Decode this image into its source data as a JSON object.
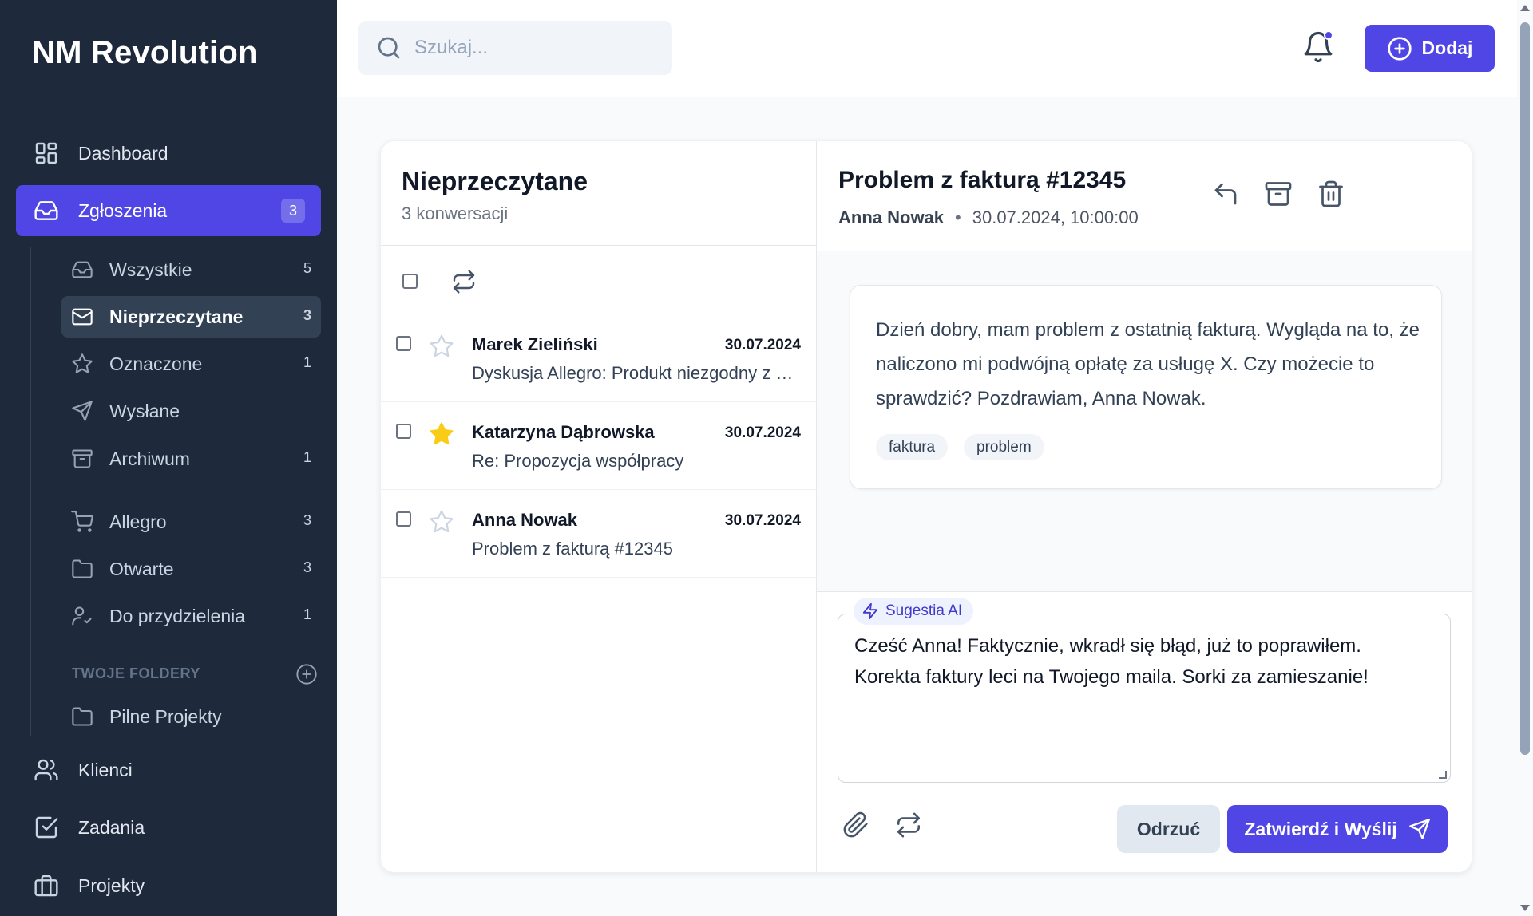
{
  "app": {
    "brand": "NM Revolution"
  },
  "nav": {
    "dashboard": "Dashboard",
    "tickets": {
      "label": "Zgłoszenia",
      "badge": "3"
    },
    "clients": "Klienci",
    "tasks": "Zadania",
    "projects": "Projekty"
  },
  "subnav": [
    {
      "label": "Wszystkie",
      "count": "5",
      "icon": "inbox-icon"
    },
    {
      "label": "Nieprzeczytane",
      "count": "3",
      "icon": "mail-icon"
    },
    {
      "label": "Oznaczone",
      "count": "1",
      "icon": "star-icon"
    },
    {
      "label": "Wysłane",
      "count": "",
      "icon": "send-icon"
    },
    {
      "label": "Archiwum",
      "count": "1",
      "icon": "archive-icon"
    },
    {
      "label": "Allegro",
      "count": "3",
      "icon": "cart-icon"
    },
    {
      "label": "Otwarte",
      "count": "3",
      "icon": "folder-icon"
    },
    {
      "label": "Do przydzielenia",
      "count": "1",
      "icon": "user-check-icon"
    }
  ],
  "folders": {
    "header": "TWOJE FOLDERY",
    "items": [
      {
        "label": "Pilne Projekty",
        "icon": "folder-icon"
      }
    ]
  },
  "topbar": {
    "search_placeholder": "Szukaj...",
    "add_label": "Dodaj"
  },
  "list": {
    "title": "Nieprzeczytane",
    "subtitle": "3 konwersacji",
    "conversations": [
      {
        "name": "Marek Zieliński",
        "date": "30.07.2024",
        "subject": "Dyskusja Allegro: Produkt niezgodny z opisem",
        "starred": false
      },
      {
        "name": "Katarzyna Dąbrowska",
        "date": "30.07.2024",
        "subject": "Re: Propozycja współpracy",
        "starred": true
      },
      {
        "name": "Anna Nowak",
        "date": "30.07.2024",
        "subject": "Problem z fakturą #12345",
        "starred": false
      }
    ]
  },
  "detail": {
    "title": "Problem z fakturą #12345",
    "author": "Anna Nowak",
    "separator": "•",
    "datetime": "30.07.2024, 10:00:00",
    "message": "Dzień dobry, mam problem z ostatnią fakturą. Wygląda na to, że naliczono mi podwójną opłatę za usługę X. Czy możecie to sprawdzić? Pozdrawiam, Anna Nowak.",
    "tags": [
      "faktura",
      "problem"
    ],
    "ai_label": "Sugestia AI",
    "reply": "Cześć Anna! Faktycznie, wkradł się błąd, już to poprawiłem. Korekta faktury leci na Twojego maila. Sorki za zamieszanie!",
    "discard_label": "Odrzuć",
    "send_label": "Zatwierdź i Wyślij"
  },
  "colors": {
    "sidebar": "#1e293b",
    "accent": "#4f46e5",
    "star": "#facc15"
  }
}
